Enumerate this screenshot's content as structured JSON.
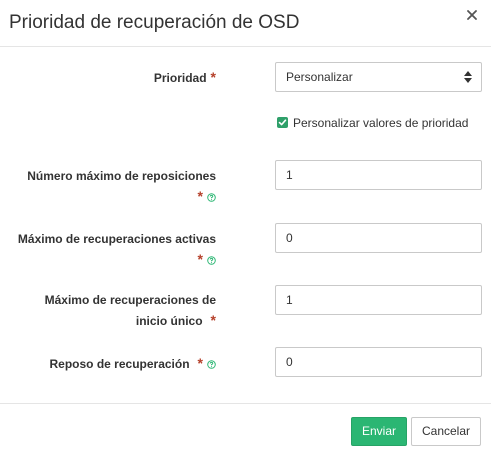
{
  "modal": {
    "title": "Prioridad de recuperación de OSD",
    "close_icon": "close-icon"
  },
  "form": {
    "priority": {
      "label": "Prioridad",
      "required_mark": "*",
      "selected": "Personalizar"
    },
    "customize_checkbox": {
      "label": "Personalizar valores de prioridad",
      "checked": true,
      "color": "#2fa06a"
    },
    "max_backfills": {
      "label_line1": "Número máximo de reposiciones",
      "required_mark": "*",
      "help_icon": "question-circle-icon",
      "value": "1"
    },
    "max_active_recoveries": {
      "label_line1": "Máximo de recuperaciones activas",
      "required_mark": "*",
      "help_icon": "question-circle-icon",
      "value": "0"
    },
    "max_single_start_recoveries": {
      "label_line1": "Máximo de recuperaciones de",
      "label_line2": "inicio único",
      "required_mark": "*",
      "value": "1"
    },
    "recovery_sleep": {
      "label": "Reposo de recuperación",
      "required_mark": "*",
      "help_icon": "question-circle-icon",
      "value": "0"
    }
  },
  "footer": {
    "submit_label": "Enviar",
    "cancel_label": "Cancelar",
    "primary_color": "#2bb673"
  },
  "colors": {
    "required": "#b5402a",
    "help": "#2bb673"
  }
}
